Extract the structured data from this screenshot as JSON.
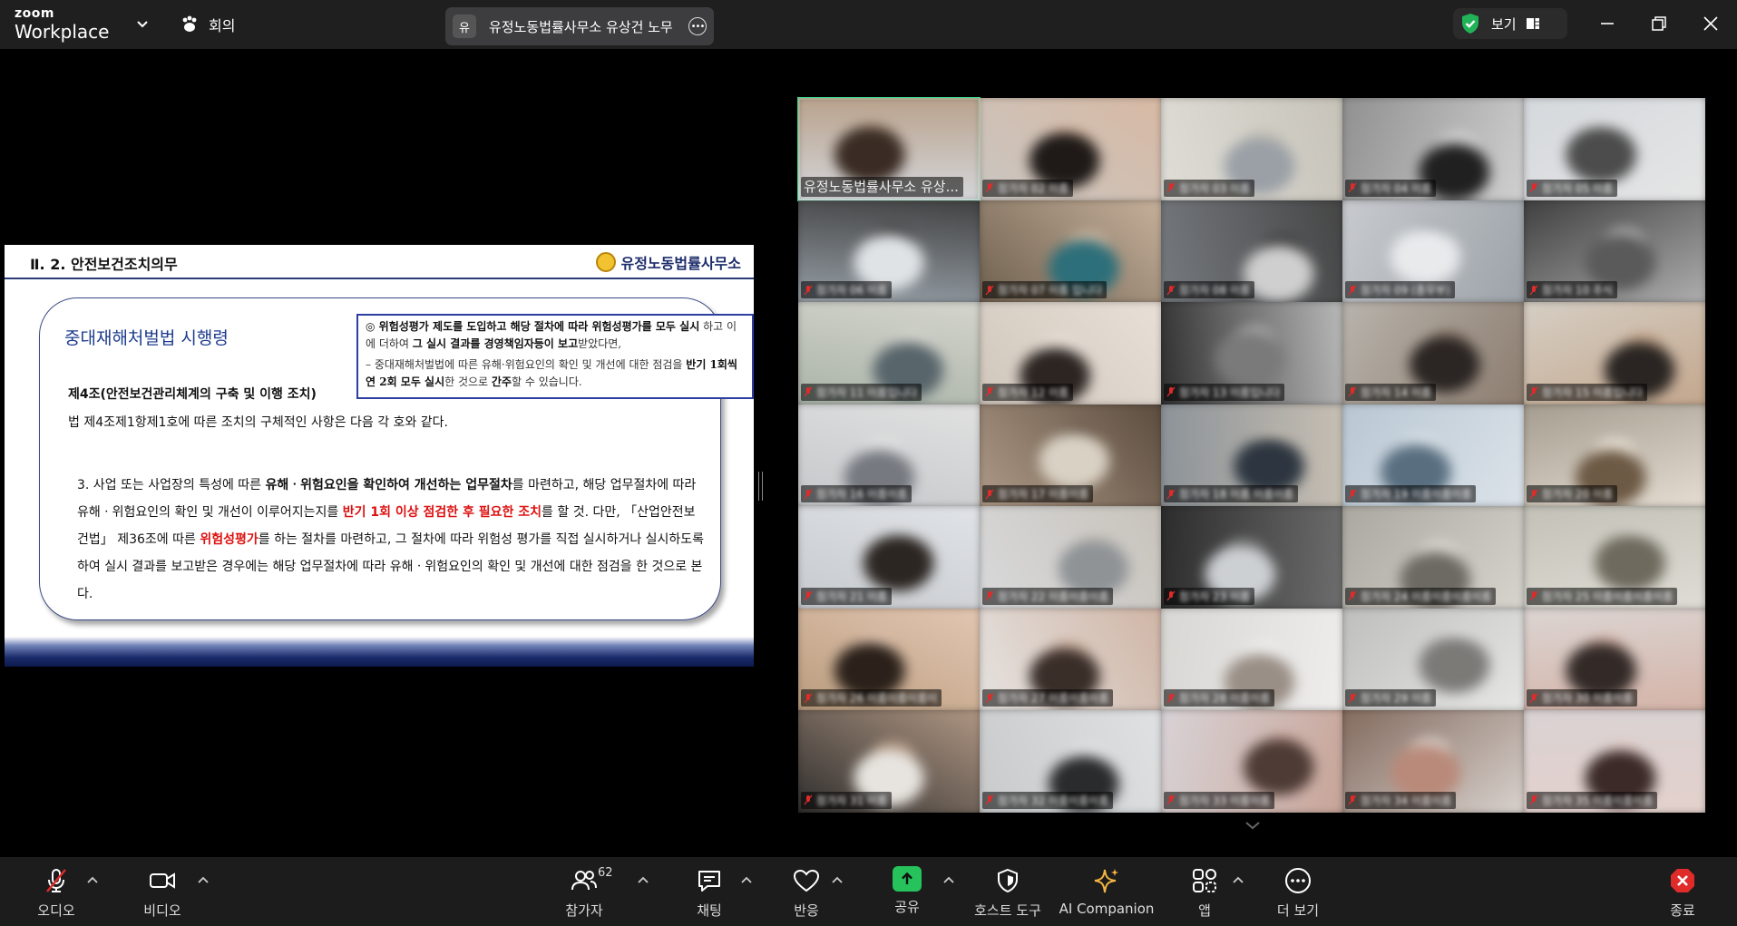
{
  "app": {
    "brand_top": "zoom",
    "brand_bottom": "Workplace",
    "meeting_menu_label": "회의"
  },
  "title_pill": {
    "badge": "유",
    "title": "유정노동법률사무소 유상건 노무"
  },
  "view_button": {
    "label": "보기"
  },
  "slide": {
    "section_title": "Ⅱ. 2. 안전보건조치의무",
    "brand": "유정노동법률사무소",
    "law_title": "중대재해처벌법 시행령",
    "article_title": "제4조(안전보건관리체계의 구축 및 이행 조치)",
    "article_desc": "법 제4조제1항제1호에 따른 조치의 구체적인 사항은 다음 각 호와 같다.",
    "clause_p1": "3. 사업 또는 사업장의 특성에 따른 ",
    "clause_em1": "유해ㆍ위험요인을 확인하여 개선하는 업무절차",
    "clause_p2": "를 마련하고, 해당 업무절차에 따라 유해ㆍ위험요인의 확인 및 개선이 이루어지는지를 ",
    "clause_red1": "반기 1회 이상 점검한 후 필요한 조치",
    "clause_p3": "를 할 것. 다만, 「산업안전보건법」 제36조에 따른 ",
    "clause_red2": "위험성평가",
    "clause_p4": "를 하는 절차를 마련하고, 그 절차에 따라 위험성 평가를 직접 실시하거나 실시하도록 하여 실시 결과를 보고받은 경우에는 해당 업무절차에 따라 유해ㆍ위험요인의 확인 및 개선에 대한 점검을 한 것으로 본다.",
    "callout_b1": "◎ 위험성평가 제도를 도입하고 해당 절차에 따라 위험성평가를 모두 실시",
    "callout_t1": "하고 이에 더하여 ",
    "callout_b2": "그 실시 결과를 경영책임자등이 보고",
    "callout_t2": "받았다면,",
    "callout_t3": "– 중대재해처벌법에 따른 유해·위험요인의 확인 및 개선에 대한 점검을",
    "callout_b3": "반기 1회씩 연 2회 모두 실시",
    "callout_t4": "한 것으로 ",
    "callout_b4": "간주",
    "callout_t5": "할 수 있습니다."
  },
  "participants": [
    {
      "name": "유정노동법률사무소 유상..."
    },
    {
      "name": "참가자 02 이름"
    },
    {
      "name": "참가자 03 이름"
    },
    {
      "name": "참가자 04 이름"
    },
    {
      "name": "참가자 05 이름"
    },
    {
      "name": "참가자 06 이름"
    },
    {
      "name": "참가자 07 이름 입니다"
    },
    {
      "name": "참가자 08 이름"
    },
    {
      "name": "참가자 09 (총무부)"
    },
    {
      "name": "참가자 10 주식"
    },
    {
      "name": "참가자 11 이름입니다"
    },
    {
      "name": "참가자 12 이름"
    },
    {
      "name": "참가자 13 이름입니다"
    },
    {
      "name": "참가자 14 이름"
    },
    {
      "name": "참가자 15 이름입니다"
    },
    {
      "name": "참가자 16 이름이름"
    },
    {
      "name": "참가자 17 이름이름"
    },
    {
      "name": "참가자 18 이름 이름이름"
    },
    {
      "name": "참가자 19 이름이름이름"
    },
    {
      "name": "참가자 20 이름"
    },
    {
      "name": "참가자 21 이름"
    },
    {
      "name": "참가자 22 이름이름이름"
    },
    {
      "name": "참가자 23 이름"
    },
    {
      "name": "참가자 24 이름이름이름이름"
    },
    {
      "name": "참가자 25 이름이름이름이름"
    },
    {
      "name": "참가자 26 이름이름이름이"
    },
    {
      "name": "참가자 27 이름이름이름"
    },
    {
      "name": "참가자 28 이름이름"
    },
    {
      "name": "참가자 29 이름"
    },
    {
      "name": "참가자 30 이름이름"
    },
    {
      "name": "참가자 31 이름"
    },
    {
      "name": "참가자 32 이름이름이름"
    },
    {
      "name": "참가자 33 이름이름"
    },
    {
      "name": "참가자 34 이름이름"
    },
    {
      "name": "참가자 35 이름이름이름"
    }
  ],
  "toolbar": {
    "audio": "오디오",
    "video": "비디오",
    "participants": "참가자",
    "participants_count": "62",
    "chat": "채팅",
    "reactions": "반응",
    "share": "공유",
    "host_tools": "호스트 도구",
    "ai_companion": "AI Companion",
    "apps": "앱",
    "more": "더 보기",
    "end": "종료"
  },
  "colors": {
    "active_speaker": "#3fd48b",
    "share_green": "#26c25b",
    "end_red": "#e02b2b",
    "secure_green": "#21b357"
  }
}
